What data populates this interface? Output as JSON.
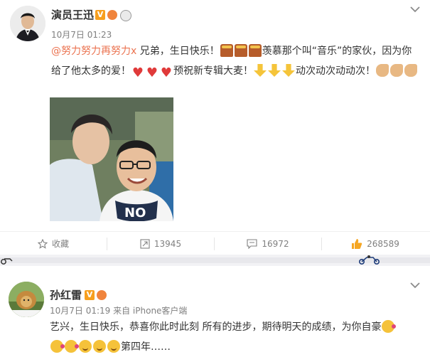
{
  "post1": {
    "username": "演员王迅",
    "meta": "10月7日 01:23",
    "text": {
      "mention": "@努力努力再努力x",
      "p1": " 兄弟，生日快乐！",
      "p2": "羡慕那个叫“音乐”的家伙，因为你给了他太多的爱！",
      "p3": "预祝新专辑大麦！",
      "p4": "动次动次动动次！"
    },
    "actions": {
      "favorite": "收藏",
      "repost": "13945",
      "comment": "16972",
      "like": "268589"
    },
    "shirt_text": "NO"
  },
  "post2": {
    "username": "孙红雷",
    "meta": "10月7日 01:19 来自 iPhone客户端",
    "text": {
      "p1": "艺兴，生日快乐，恭喜你此时此刻 所有的进步，期待明天的成绩，为你自豪",
      "p2": "第四年……"
    }
  },
  "colors": {
    "mention": "#eb7350",
    "vip_badge": "#f79f1e",
    "like": "#f5a623"
  },
  "icons": [
    "star-icon",
    "repost-icon",
    "comment-icon",
    "like-icon",
    "chevron-down-icon"
  ]
}
